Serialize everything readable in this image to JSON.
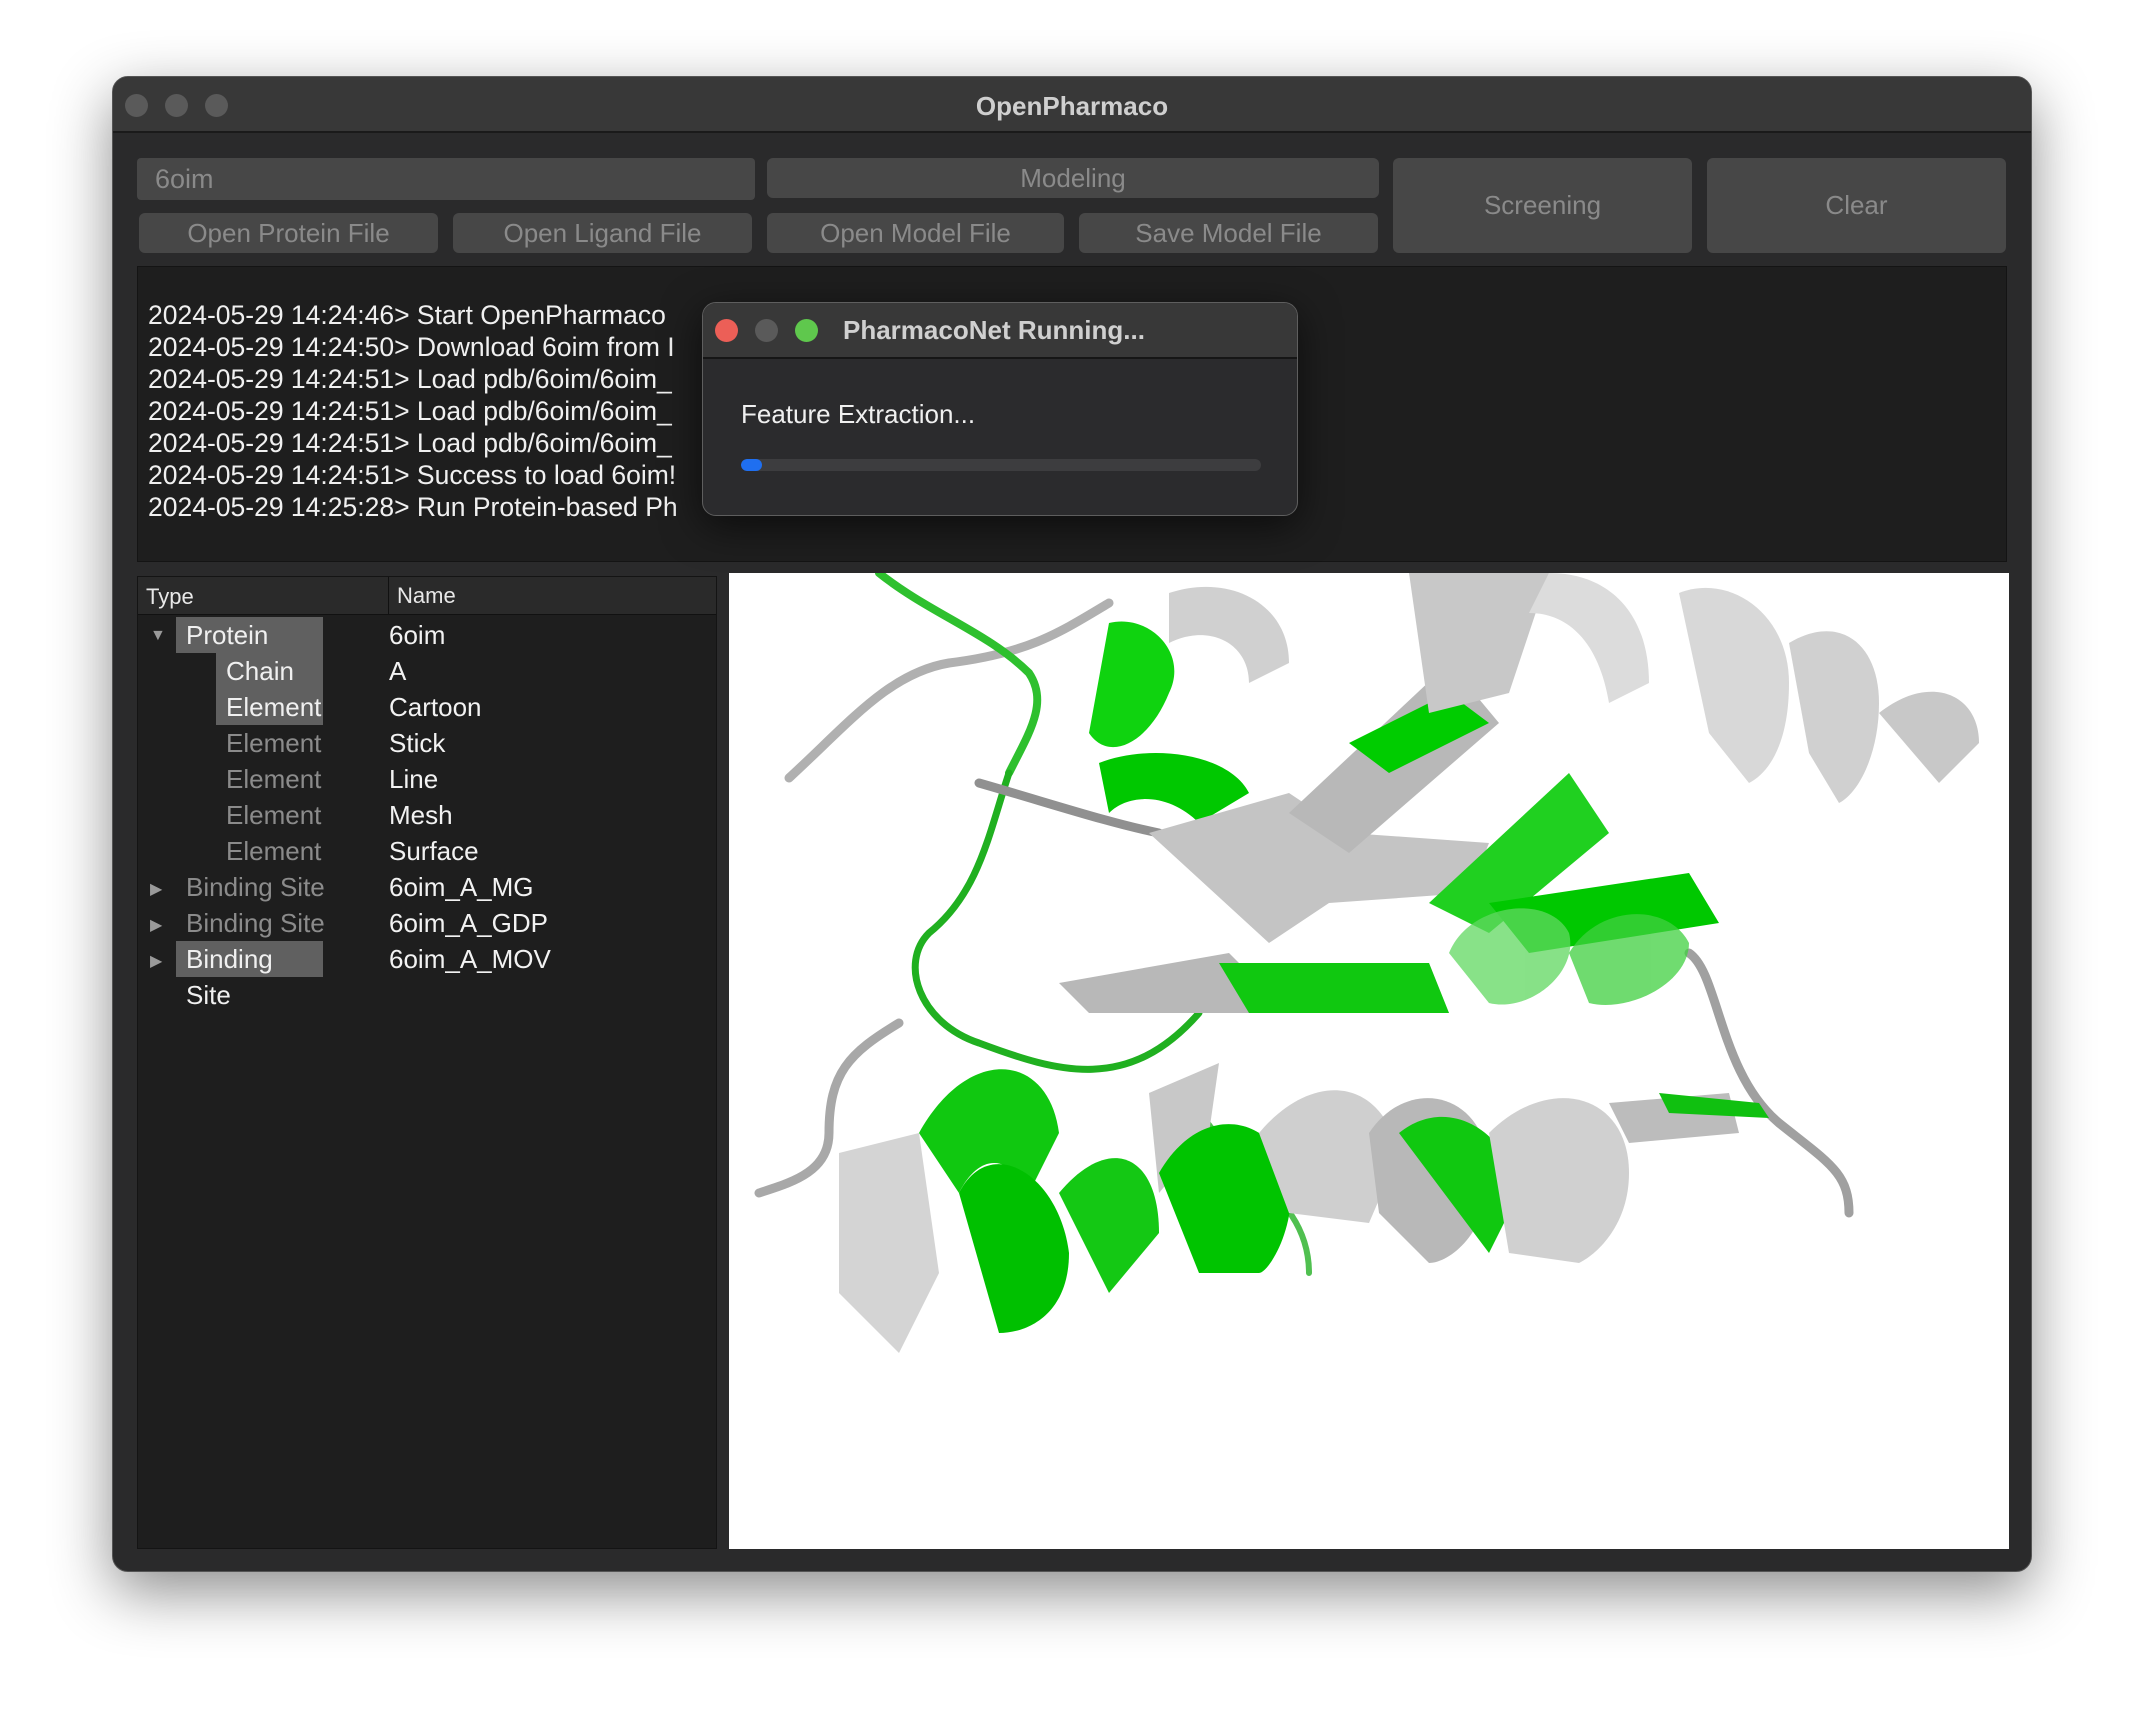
{
  "window": {
    "title": "OpenPharmaco"
  },
  "toolbar": {
    "pdb_input_value": "6oim",
    "modeling": "Modeling",
    "open_protein": "Open Protein File",
    "open_ligand": "Open Ligand File",
    "open_model": "Open Model File",
    "save_model": "Save Model File",
    "screening": "Screening",
    "clear": "Clear"
  },
  "log": [
    "2024-05-29 14:24:46> Start OpenPharmaco",
    "2024-05-29 14:24:50> Download 6oim from I",
    "2024-05-29 14:24:51> Load pdb/6oim/6oim_",
    "2024-05-29 14:24:51> Load pdb/6oim/6oim_",
    "2024-05-29 14:24:51> Load pdb/6oim/6oim_",
    "2024-05-29 14:24:51> Success to load 6oim!",
    "2024-05-29 14:25:28> Run Protein-based Ph"
  ],
  "tree": {
    "headers": {
      "type": "Type",
      "name": "Name"
    },
    "rows": [
      {
        "type": "Protein",
        "name": "6oim"
      },
      {
        "type": "Chain",
        "name": "A"
      },
      {
        "type": "Element",
        "name": "Cartoon"
      },
      {
        "type": "Element",
        "name": "Stick"
      },
      {
        "type": "Element",
        "name": "Line"
      },
      {
        "type": "Element",
        "name": "Mesh"
      },
      {
        "type": "Element",
        "name": "Surface"
      },
      {
        "type": "Binding Site",
        "name": "6oim_A_MG"
      },
      {
        "type": "Binding Site",
        "name": "6oim_A_GDP"
      },
      {
        "type": "Binding Site",
        "name": "6oim_A_MOV"
      }
    ]
  },
  "dialog": {
    "title": "PharmacoNet Running...",
    "message": "Feature Extraction...",
    "progress_percent": 4,
    "progress_color": "#1f6ff0"
  },
  "viewer": {
    "colors": {
      "highlight": "#00d000",
      "base": "#c8c8c8"
    }
  }
}
